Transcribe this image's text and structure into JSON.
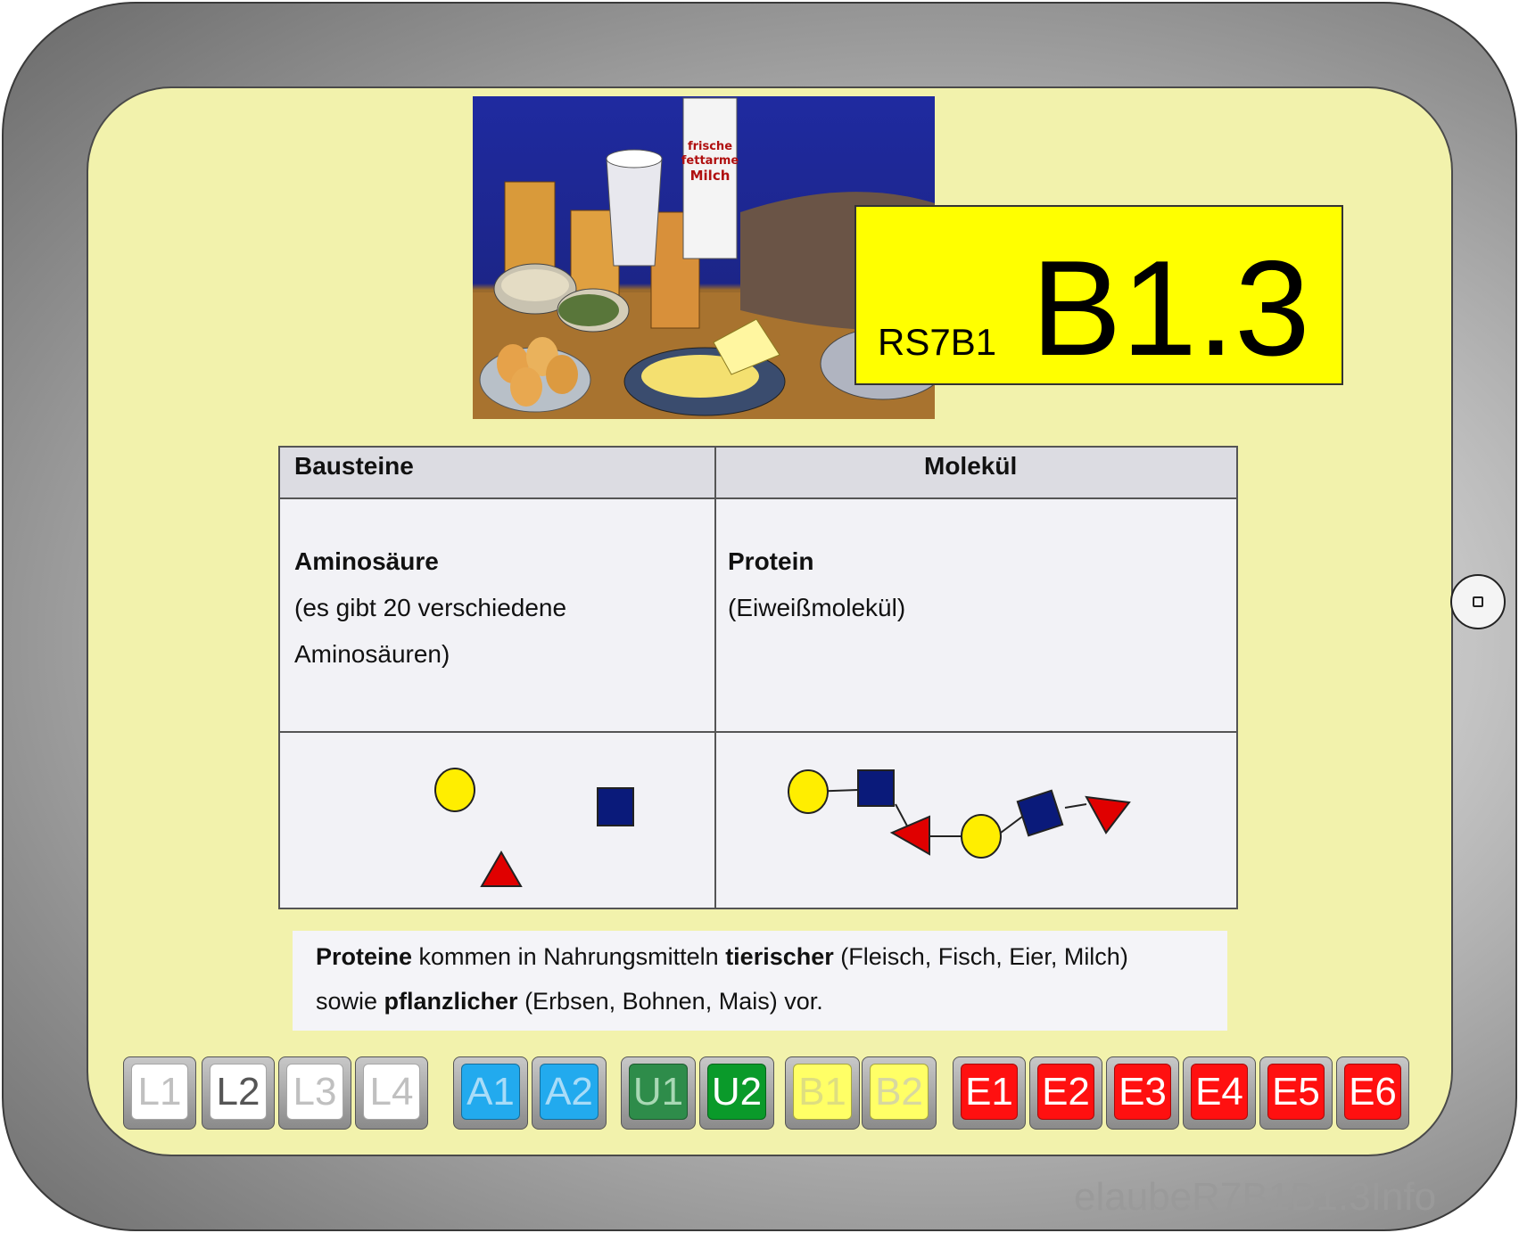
{
  "content_code": {
    "prefix": "RS7B1",
    "main": "B1.3"
  },
  "table": {
    "headers": [
      "Bausteine",
      "Molekül"
    ],
    "left_cell": {
      "title": "Aminosäure",
      "lines": [
        "(es gibt 20 verschiedene",
        "Aminosäuren)"
      ]
    },
    "right_cell": {
      "title": "Protein",
      "lines": [
        "(Eiweißmolekül)"
      ]
    }
  },
  "note": {
    "line1": {
      "b1": "Proteine",
      "t1": " kommen in Nahrungsmitteln ",
      "b2": "tierischer",
      "t2": " (Fleisch, Fisch, Eier, Milch)"
    },
    "line2": {
      "t1": "sowie ",
      "b1": "pflanzlicher",
      "t2": " (Erbsen, Bohnen, Mais) vor."
    }
  },
  "photo_labels": {
    "milk": "frische fettarme Milch"
  },
  "shape_colors": {
    "circle": "#ffee00",
    "square": "#0a1a7a",
    "triangle": "#e00000"
  },
  "nav": {
    "buttons": [
      {
        "label": "L1",
        "color": "#ffffff",
        "text_color": "#c0c0c0"
      },
      {
        "label": "L2",
        "color": "#ffffff",
        "text_color": "#555555"
      },
      {
        "label": "L3",
        "color": "#ffffff",
        "text_color": "#c0c0c0"
      },
      {
        "label": "L4",
        "color": "#ffffff",
        "text_color": "#c0c0c0"
      },
      {
        "label": "A1",
        "color": "#22aaee",
        "text_color": "#a8dcf8"
      },
      {
        "label": "A2",
        "color": "#22aaee",
        "text_color": "#a8dcf8"
      },
      {
        "label": "U1",
        "color": "#2e8c4a",
        "text_color": "#a8d8b4"
      },
      {
        "label": "U2",
        "color": "#0a9a2a",
        "text_color": "#ffffff"
      },
      {
        "label": "B1",
        "color": "#ffff66",
        "text_color": "#dede80"
      },
      {
        "label": "B2",
        "color": "#ffff66",
        "text_color": "#d8d8a0"
      },
      {
        "label": "E1",
        "color": "#ff1010",
        "text_color": "#ffffff"
      },
      {
        "label": "E2",
        "color": "#ff1010",
        "text_color": "#ffffff"
      },
      {
        "label": "E3",
        "color": "#ff1010",
        "text_color": "#ffffff"
      },
      {
        "label": "E4",
        "color": "#ff1010",
        "text_color": "#ffffff"
      },
      {
        "label": "E5",
        "color": "#ff1010",
        "text_color": "#ffffff"
      },
      {
        "label": "E6",
        "color": "#ff1010",
        "text_color": "#ffffff"
      }
    ]
  },
  "footer": {
    "label": "elaubeR7B1B1.3Info"
  }
}
